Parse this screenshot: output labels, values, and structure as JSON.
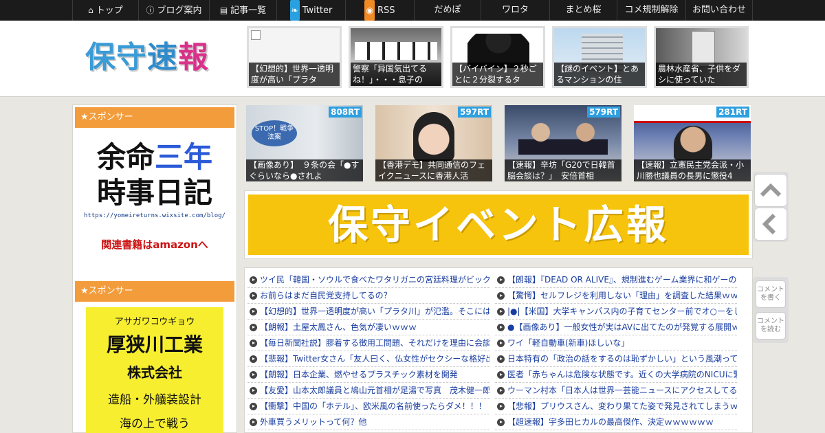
{
  "topnav": [
    {
      "icon": "home-icon",
      "label": "トップ"
    },
    {
      "icon": "info-icon",
      "label": "ブログ案内"
    },
    {
      "icon": "list-icon",
      "label": "記事一覧"
    },
    {
      "icon": "twitter-icon",
      "label": "Twitter"
    },
    {
      "icon": "rss-icon",
      "label": "RSS"
    },
    {
      "label": "だめぽ"
    },
    {
      "label": "ワロタ"
    },
    {
      "label": "まとめ桜"
    },
    {
      "label": "コメ規制解除"
    },
    {
      "label": "お問い合わせ"
    }
  ],
  "logo": {
    "c1": "保",
    "c2": "守",
    "c3": "速",
    "c4": "報"
  },
  "header_thumbs": [
    "【幻想的】世界一透明度が高い「プラタ",
    "警察「异国気出てるね！」・・・息子の",
    "【バイバイン】２秒ごとに２分裂するタ",
    "【謎のイベント】とあるマンションの住",
    "農林水産省、子供をダシに使っていた"
  ],
  "sidebar": {
    "sponsor1": "★スポンサー",
    "ad1": {
      "line1a": "余命",
      "line1b": "三年",
      "line2": "時事日記",
      "url": "https://yomeireturns.wixsite.com/blog/",
      "amazon": "関連書籍はamazonへ"
    },
    "sponsor2": "★スポンサー",
    "ad2": {
      "kana": "アサガワコウギョウ",
      "name": "厚狭川工業",
      "corp": "株式会社",
      "svc": "造船・外艤装設計",
      "more": "海の上で戦う"
    }
  },
  "rt_thumbs": [
    {
      "rt": "808RT",
      "cap": "【画像あり】　９条の会「●すぐらいなら●されよ",
      "overlay": "STOP！戦争法案"
    },
    {
      "rt": "597RT",
      "cap": "【香港デモ】共同通信のフェイクニュースに香港人活"
    },
    {
      "rt": "579RT",
      "cap": "【速報】辛坊「G20で日韓首脳会談は？」　安倍首相"
    },
    {
      "rt": "281RT",
      "cap": "【速報】立憲民主党会派・小川勝也議員の長男に懲役4"
    }
  ],
  "banner": "保守イベント広報",
  "list_left": [
    "ツイ民「韓国・ソウルで食べたワタリガニの宮廷料理がビック",
    "お前らはまだ自民党支持してるの？",
    "【幻想的】世界一透明度が高い「プラタ川」が氾濫。そこには",
    "【朗報】土屋太鳳さん、色気が凄いｗｗｗ",
    "【毎日新聞社説】膠着する徴用工問題、それだけを理由に会談",
    "【悲報】Twitter女さん「友人曰く、仏女性がセクシーな格好出",
    "【朗報】日本企業、燃やせるプラスチック素材を開発",
    "【友愛】山本太郎議員と鳩山元首相が足湯で写真　茂木健一郎",
    "【衝撃】中国の「ホテル」、欧米風の名前使ったらダメ！！！",
    "外車買うメリットって何？他"
  ],
  "list_right": [
    "【朗報】『DEAD OR ALIVE』、規制進むゲーム業界に和ゲーの",
    "【驚愕】セルフレジを利用しない「理由」を調査した結果ｗｗ",
    "|●|【米国】大学キャンパス内の子育てセンター前でオ○ーをし",
    "●【画像あり】一般女性が実はAVに出てたのが発覚する展開ｗ",
    "ワイ「軽自動車(新車)ほしいな」",
    "日本特有の「政治の話をするのは恥ずかしい」という風潮って",
    "医者「赤ちゃんは危険な状態です。近くの大学病院のNICUに緊",
    "ウーマン村本「日本人は世界一芸能ニュースにアクセスしてる",
    "【悲報】プリウスさん、変わり果てた姿で発見されてしまうｗ",
    "【超速報】宇多田ヒカルの最高傑作、決定ｗｗｗｗｗｗ"
  ],
  "side_buttons": {
    "comment_write": "コメントを書く",
    "comment_read": "コメントを読む"
  },
  "colors": {
    "nav_bg": "#1b1b1b",
    "sponsor": "#f39c3b",
    "rt_badge": "#2e9fe0",
    "banner": "#f6c40c",
    "link": "#1a3ea0"
  }
}
